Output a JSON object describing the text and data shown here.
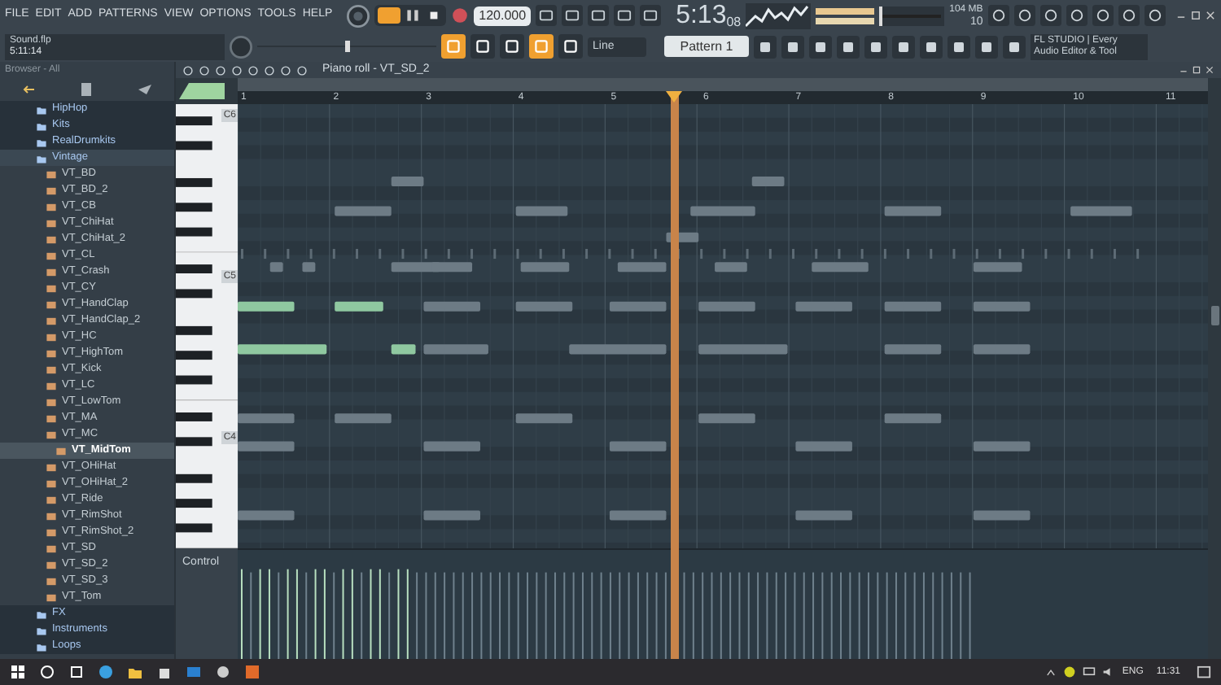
{
  "menu": [
    "FILE",
    "EDIT",
    "ADD",
    "PATTERNS",
    "VIEW",
    "OPTIONS",
    "TOOLS",
    "HELP"
  ],
  "tempo": "120.000",
  "time": {
    "main": "5:13",
    "sub": "08"
  },
  "memory": "104 MB",
  "polyphony": "10",
  "hint": {
    "title": "Sound.flp",
    "time": "5:11:14"
  },
  "snap": "Line",
  "pattern": "Pattern 1",
  "news": "FL STUDIO | Every Audio Editor & Tool",
  "browser": {
    "title": "Browser - All",
    "items": [
      {
        "label": "HipHop",
        "kind": "folder",
        "selected": false
      },
      {
        "label": "Kits",
        "kind": "folder",
        "selected": false
      },
      {
        "label": "RealDrumkits",
        "kind": "folder",
        "selected": false
      },
      {
        "label": "Vintage",
        "kind": "folder",
        "selected": true
      },
      {
        "label": "VT_BD",
        "kind": "sample",
        "selected": false
      },
      {
        "label": "VT_BD_2",
        "kind": "sample",
        "selected": false
      },
      {
        "label": "VT_CB",
        "kind": "sample",
        "selected": false
      },
      {
        "label": "VT_ChiHat",
        "kind": "sample",
        "selected": false
      },
      {
        "label": "VT_ChiHat_2",
        "kind": "sample",
        "selected": false
      },
      {
        "label": "VT_CL",
        "kind": "sample",
        "selected": false
      },
      {
        "label": "VT_Crash",
        "kind": "sample",
        "selected": false
      },
      {
        "label": "VT_CY",
        "kind": "sample",
        "selected": false
      },
      {
        "label": "VT_HandClap",
        "kind": "sample",
        "selected": false
      },
      {
        "label": "VT_HandClap_2",
        "kind": "sample",
        "selected": false
      },
      {
        "label": "VT_HC",
        "kind": "sample",
        "selected": false
      },
      {
        "label": "VT_HighTom",
        "kind": "sample",
        "selected": false
      },
      {
        "label": "VT_Kick",
        "kind": "sample",
        "selected": false
      },
      {
        "label": "VT_LC",
        "kind": "sample",
        "selected": false
      },
      {
        "label": "VT_LowTom",
        "kind": "sample",
        "selected": false
      },
      {
        "label": "VT_MA",
        "kind": "sample",
        "selected": false
      },
      {
        "label": "VT_MC",
        "kind": "sample",
        "selected": false
      },
      {
        "label": "VT_MidTom",
        "kind": "sample",
        "selected": true
      },
      {
        "label": "VT_OHiHat",
        "kind": "sample",
        "selected": false
      },
      {
        "label": "VT_OHiHat_2",
        "kind": "sample",
        "selected": false
      },
      {
        "label": "VT_Ride",
        "kind": "sample",
        "selected": false
      },
      {
        "label": "VT_RimShot",
        "kind": "sample",
        "selected": false
      },
      {
        "label": "VT_RimShot_2",
        "kind": "sample",
        "selected": false
      },
      {
        "label": "VT_SD",
        "kind": "sample",
        "selected": false
      },
      {
        "label": "VT_SD_2",
        "kind": "sample",
        "selected": false
      },
      {
        "label": "VT_SD_3",
        "kind": "sample",
        "selected": false
      },
      {
        "label": "VT_Tom",
        "kind": "sample",
        "selected": false
      },
      {
        "label": "FX",
        "kind": "folder",
        "selected": false
      },
      {
        "label": "Instruments",
        "kind": "folder",
        "selected": false
      },
      {
        "label": "Loops",
        "kind": "folder",
        "selected": false
      }
    ]
  },
  "piano_roll": {
    "title": "Piano roll - VT_SD_2",
    "ruler": [
      "1",
      "2",
      "3",
      "4",
      "5",
      "6",
      "7",
      "8",
      "9",
      "10",
      "11"
    ],
    "octaves": [
      "C6",
      "C5",
      "C4"
    ],
    "control_label": "Control"
  },
  "taskbar": {
    "language": "ENG",
    "clock": "11:31"
  }
}
